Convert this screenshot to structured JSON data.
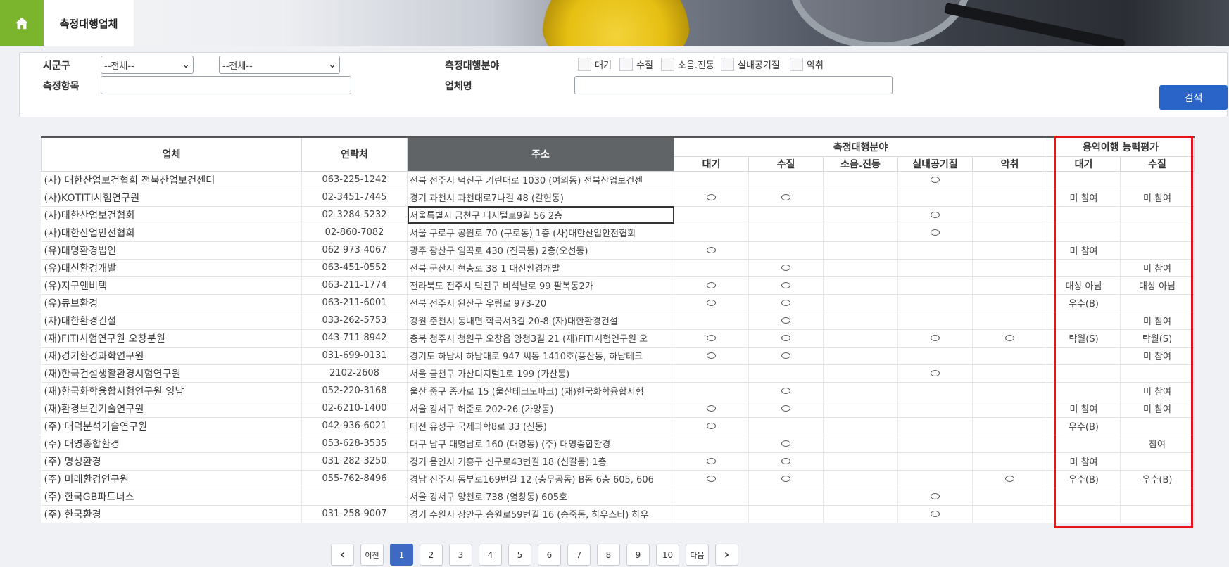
{
  "header": {
    "home_icon": "home-icon",
    "page_title": "측정대행업체"
  },
  "colors": {
    "home_green": "#7ab52d",
    "search_button": "#2b64c9",
    "active_page": "#3f6ac4",
    "highlight_frame": "#e5151b",
    "address_header": "#606467"
  },
  "filters": {
    "sigungu_label": "시군구",
    "sigungu_select_1": "--전체--",
    "sigungu_select_2": "--전체--",
    "item_label": "측정항목",
    "item_value": "",
    "field_label": "측정대행분야",
    "field_options": [
      "대기",
      "수질",
      "소음.진동",
      "실내공기질",
      "악취"
    ],
    "company_label": "업체명",
    "company_value": "",
    "search_button": "검색"
  },
  "table": {
    "headers": {
      "company": "업체",
      "contact": "연락처",
      "address": "주소",
      "field_group": "측정대행분야",
      "eval_group": "용역이행 능력평가"
    },
    "field_columns": [
      "대기",
      "수질",
      "소음.진동",
      "실내공기질",
      "악취"
    ],
    "eval_columns": [
      "대기",
      "수질"
    ],
    "mark_symbol": "○",
    "rows": [
      {
        "name": "(사) 대한산업보건협회 전북산업보건센터",
        "tel": "063-225-1242",
        "addr": "전북 전주시 덕진구 기린대로 1030 (여의동) 전북산업보건센",
        "fields": [
          false,
          false,
          false,
          true,
          false
        ],
        "eval": [
          "",
          ""
        ]
      },
      {
        "name": "(사)KOTITI시험연구원",
        "tel": "02-3451-7445",
        "addr": "경기 과천시 과천대로7나길 48 (갈현동)",
        "fields": [
          true,
          true,
          false,
          false,
          false
        ],
        "eval": [
          "미 참여",
          "미 참여"
        ]
      },
      {
        "name": "(사)대한산업보건협회",
        "tel": "02-3284-5232",
        "addr": "서울특별시 금천구 디지털로9길 56 2층",
        "fields": [
          false,
          false,
          false,
          true,
          false
        ],
        "eval": [
          "",
          ""
        ]
      },
      {
        "name": "(사)대한산업안전협회",
        "tel": "02-860-7082",
        "addr": "서울 구로구 공원로 70 (구로동) 1층 (사)대한산업안전협회",
        "fields": [
          false,
          false,
          false,
          true,
          false
        ],
        "eval": [
          "",
          ""
        ]
      },
      {
        "name": "(유)대명환경법인",
        "tel": "062-973-4067",
        "addr": "광주 광산구 임곡로 430 (진곡동) 2층(오선동)",
        "fields": [
          true,
          false,
          false,
          false,
          false
        ],
        "eval": [
          "미 참여",
          ""
        ]
      },
      {
        "name": "(유)대신환경개발",
        "tel": "063-451-0552",
        "addr": "전북 군산시 현충로 38-1 대신환경개발",
        "fields": [
          false,
          true,
          false,
          false,
          false
        ],
        "eval": [
          "",
          "미 참여"
        ]
      },
      {
        "name": "(유)지구엔비텍",
        "tel": "063-211-1774",
        "addr": "전라북도 전주시 덕진구 비석날로 99 팔복동2가",
        "fields": [
          true,
          true,
          false,
          false,
          false
        ],
        "eval": [
          "대상 아님",
          "대상 아님"
        ]
      },
      {
        "name": "(유)큐브환경",
        "tel": "063-211-6001",
        "addr": "전북 전주시 완산구 우림로 973-20",
        "fields": [
          true,
          true,
          false,
          false,
          false
        ],
        "eval": [
          "우수(B)",
          ""
        ]
      },
      {
        "name": "(자)대한환경건설",
        "tel": "033-262-5753",
        "addr": "강원 춘천시 동내면 학곡서3길 20-8 (자)대한환경건설",
        "fields": [
          false,
          true,
          false,
          false,
          false
        ],
        "eval": [
          "",
          "미 참여"
        ]
      },
      {
        "name": "(재)FITI시험연구원 오창분원",
        "tel": "043-711-8942",
        "addr": "충북 청주시 청원구 오창읍 양청3길 21 (재)FITI시험연구원 오",
        "fields": [
          true,
          true,
          false,
          true,
          true
        ],
        "eval": [
          "탁월(S)",
          "탁월(S)"
        ]
      },
      {
        "name": "(재)경기환경과학연구원",
        "tel": "031-699-0131",
        "addr": "경기도 하남시 하남대로 947 씨동 1410호(풍산동, 하남테크",
        "fields": [
          true,
          true,
          false,
          false,
          false
        ],
        "eval": [
          "",
          "미 참여"
        ]
      },
      {
        "name": "(재)한국건설생활환경시험연구원",
        "tel": "2102-2608",
        "addr": "서울 금천구 가산디지털1로 199 (가산동)",
        "fields": [
          false,
          false,
          false,
          true,
          false
        ],
        "eval": [
          "",
          ""
        ]
      },
      {
        "name": "(재)한국화학융합시험연구원 영남",
        "tel": "052-220-3168",
        "addr": "울산 중구 종가로 15 (울산테크노파크) (재)한국화학융합시험",
        "fields": [
          false,
          true,
          false,
          false,
          false
        ],
        "eval": [
          "",
          "미 참여"
        ]
      },
      {
        "name": "(재)환경보건기술연구원",
        "tel": "02-6210-1400",
        "addr": "서울 강서구 허준로 202-26 (가양동)",
        "fields": [
          true,
          true,
          false,
          false,
          false
        ],
        "eval": [
          "미 참여",
          "미 참여"
        ]
      },
      {
        "name": "(주) 대덕분석기술연구원",
        "tel": "042-936-6021",
        "addr": "대전 유성구 국제과학8로 33 (신동)",
        "fields": [
          true,
          false,
          false,
          false,
          false
        ],
        "eval": [
          "우수(B)",
          ""
        ]
      },
      {
        "name": "(주) 대영종합환경",
        "tel": "053-628-3535",
        "addr": "대구 남구 대명남로 160 (대명동) (주) 대영종합환경",
        "fields": [
          false,
          true,
          false,
          false,
          false
        ],
        "eval": [
          "",
          "참여"
        ]
      },
      {
        "name": "(주) 명성환경",
        "tel": "031-282-3250",
        "addr": "경기 용인시 기흥구 신구로43번길 18 (신갈동) 1층",
        "fields": [
          true,
          true,
          false,
          false,
          false
        ],
        "eval": [
          "미 참여",
          ""
        ]
      },
      {
        "name": "(주) 미래환경연구원",
        "tel": "055-762-8496",
        "addr": "경남 진주시 동부로169번길 12 (충무공동) B동 6층 605, 606",
        "fields": [
          true,
          true,
          false,
          false,
          true
        ],
        "eval": [
          "우수(B)",
          "우수(B)"
        ]
      },
      {
        "name": "(주) 한국GB파트너스",
        "tel": "",
        "addr": "서울 강서구 양천로 738 (염창동) 605호",
        "fields": [
          false,
          false,
          false,
          true,
          false
        ],
        "eval": [
          "",
          ""
        ]
      },
      {
        "name": "(주) 한국환경",
        "tel": "031-258-9007",
        "addr": "경기 수원시 장안구 송원로59번길 16 (송죽동, 하우스타) 하우",
        "fields": [
          false,
          false,
          false,
          true,
          false
        ],
        "eval": [
          "",
          ""
        ]
      }
    ]
  },
  "pagination": {
    "prev_icon": "chevron-left-icon",
    "prev_label": "이전",
    "pages": [
      "1",
      "2",
      "3",
      "4",
      "5",
      "6",
      "7",
      "8",
      "9",
      "10"
    ],
    "current_page": "1",
    "next_label": "다음",
    "next_icon": "chevron-right-icon"
  }
}
